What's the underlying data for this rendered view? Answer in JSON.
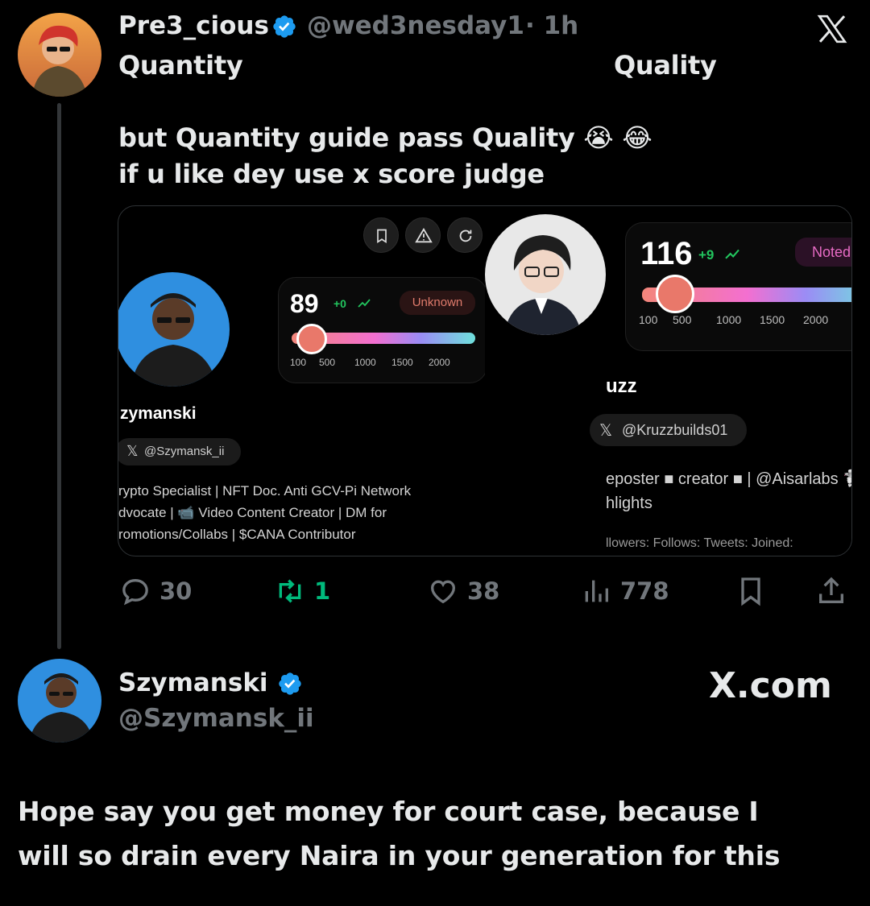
{
  "tweet": {
    "author_name": "Pre3_cious",
    "author_handle": "@wed3nesday1",
    "time": "· 1h",
    "quantity_word": "Quantity",
    "quality_word": "Quality",
    "line1": "but Quantity guide pass Quality 😭 😂",
    "line2": "if u like dey use x score judge",
    "stats": {
      "replies": "30",
      "reposts": "1",
      "likes": "38",
      "views": "778"
    }
  },
  "card": {
    "left": {
      "score": "89",
      "delta": "+0",
      "tag": "Unknown",
      "slider_fraction": 0.11,
      "ticks": [
        "100",
        "500",
        "1000",
        "1500",
        "2000"
      ],
      "name": "zymanski",
      "handle": "@Szymansk_ii",
      "bio1": "rypto Specialist | NFT Doc. Anti GCV-Pi Network",
      "bio2": "dvocate | 📹 Video Content Creator | DM for",
      "bio3": "romotions/Collabs | $CANA Contributor"
    },
    "right": {
      "score": "116",
      "delta": "+9",
      "tag": "Noted",
      "slider_fraction": 0.14,
      "ticks": [
        "100",
        "500",
        "1000",
        "1500",
        "2000"
      ],
      "name": "uzz",
      "handle": "@Kruzzbuilds01",
      "bio1": "eposter ■ creator ■ | @Aisarlabs 🐩 ➾ check",
      "bio2": "hlights",
      "stats_cut": "llowers:        Follows:        Tweets:        Joined:"
    }
  },
  "reply": {
    "author_name": "Szymanski",
    "author_handle": "@Szymansk_ii",
    "watermark": "X.com",
    "text1": "Hope say you get money for court case, because I",
    "text2": "will so drain every Naira in your generation for this"
  },
  "colors": {
    "background": "#000000",
    "text": "#e7e9ea",
    "muted": "#71767b",
    "verified": "#1d9bf0",
    "repost_green": "#00ba7c"
  },
  "icons": [
    "x-logo-icon",
    "verified-badge-icon",
    "reply-icon",
    "repost-icon",
    "like-icon",
    "views-icon",
    "bookmark-icon",
    "share-icon"
  ]
}
